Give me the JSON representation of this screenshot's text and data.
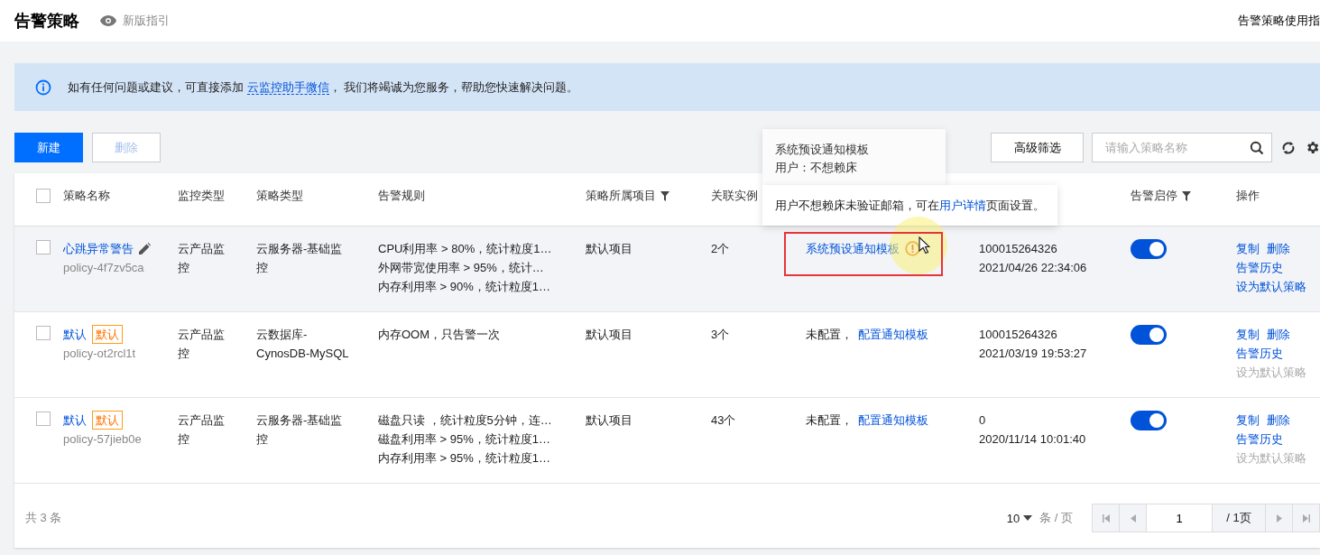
{
  "header": {
    "title": "告警策略",
    "guide_link": "新版指引",
    "help_link": "告警策略使用指"
  },
  "banner": {
    "before": "如有任何问题或建议，可直接添加 ",
    "link": "云监控助手微信",
    "after": "， 我们将竭诚为您服务，帮助您快速解决问题。"
  },
  "toolbar": {
    "buttons": [
      {
        "label": "新建",
        "kind": "primary",
        "disabled": false
      },
      {
        "label": "删除",
        "kind": "default",
        "disabled": true
      }
    ],
    "filter_button": "高级筛选",
    "search": {
      "placeholder": "请输入策略名称"
    }
  },
  "table": {
    "all_selected": false,
    "columns": [
      {
        "label": "策略名称",
        "filter": false
      },
      {
        "label": "监控类型",
        "filter": false
      },
      {
        "label": "策略类型",
        "filter": false
      },
      {
        "label": "告警规则",
        "filter": false
      },
      {
        "label": "策略所属项目",
        "filter": true
      },
      {
        "label": "关联实例",
        "filter": false
      },
      {
        "label": "告警启停",
        "filter": true
      },
      {
        "label": "操作",
        "filter": false
      }
    ],
    "rows": [
      {
        "selected": false,
        "hovered": true,
        "name": "心跳异常警告",
        "editable": true,
        "id": "policy-4f7zv5ca",
        "monitor_type": "云产品监控",
        "policy_type": "云服务器-基础监控",
        "rules": [
          "CPU利用率 > 80%，统计粒度1…",
          "外网带宽使用率 > 95%，统计…",
          "内存利用率 > 90%，统计粒度1…"
        ],
        "project": "默认项目",
        "instances": "2个",
        "notice": {
          "link": "系统预设通知模板",
          "warning": true
        },
        "modifier": "100015264326",
        "modified": "2021/04/26 22:34:06",
        "enabled": true,
        "actions": [
          {
            "label": "复制",
            "disabled": false
          },
          {
            "label": "删除",
            "disabled": false
          },
          {
            "label": "告警历史",
            "disabled": false
          },
          {
            "label": "设为默认策略",
            "disabled": false
          }
        ]
      },
      {
        "selected": false,
        "hovered": false,
        "name": "默认",
        "tag": "默认",
        "editable": false,
        "id": "policy-ot2rcl1t",
        "monitor_type": "云产品监控",
        "policy_type": "云数据库-CynosDB-MySQL",
        "rules": [
          "内存OOM，只告警一次"
        ],
        "project": "默认项目",
        "instances": "3个",
        "notice": {
          "text": "未配置，",
          "link": "配置通知模板",
          "warning": false
        },
        "modifier": "100015264326",
        "modified": "2021/03/19 19:53:27",
        "enabled": true,
        "actions": [
          {
            "label": "复制",
            "disabled": false
          },
          {
            "label": "删除",
            "disabled": false
          },
          {
            "label": "告警历史",
            "disabled": false
          },
          {
            "label": "设为默认策略",
            "disabled": true
          }
        ]
      },
      {
        "selected": false,
        "hovered": false,
        "name": "默认",
        "tag": "默认",
        "editable": false,
        "id": "policy-57jieb0e",
        "monitor_type": "云产品监控",
        "policy_type": "云服务器-基础监控",
        "rules": [
          "磁盘只读 ，统计粒度5分钟，连…",
          "磁盘利用率 > 95%，统计粒度1…",
          "内存利用率 > 95%，统计粒度1…"
        ],
        "project": "默认项目",
        "instances": "43个",
        "notice": {
          "text": "未配置，",
          "link": "配置通知模板",
          "warning": false
        },
        "modifier": "0",
        "modified": "2020/11/14 10:01:40",
        "enabled": true,
        "actions": [
          {
            "label": "复制",
            "disabled": false
          },
          {
            "label": "删除",
            "disabled": false
          },
          {
            "label": "告警历史",
            "disabled": false
          },
          {
            "label": "设为默认策略",
            "disabled": true
          }
        ]
      }
    ]
  },
  "pagination": {
    "total": "共 3 条",
    "page_size": "10",
    "page_size_unit": "条 / 页",
    "page": "1",
    "page_count": "/ 1页"
  },
  "template_popover": {
    "lines": [
      "系统预设通知模板",
      "用户：不想赖床"
    ]
  },
  "warning_popover": {
    "before": "用户不想赖床未验证邮箱，可在",
    "link": "用户详情",
    "after": "页面设置。"
  }
}
